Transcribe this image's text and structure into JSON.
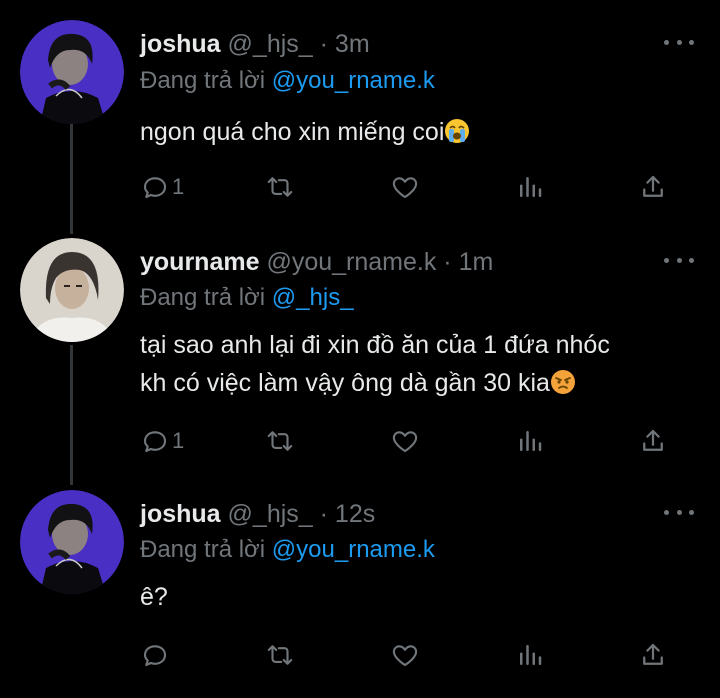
{
  "colors": {
    "background": "#000000",
    "text": "#e7e9ea",
    "muted": "#71767b",
    "accent": "#1d9bf0",
    "thread_line": "#333639"
  },
  "tweets": [
    {
      "name": "joshua",
      "handle": "@_hjs_",
      "separator": "·",
      "time": "3m",
      "replying_prefix": "Đang trả lời",
      "replying_to": "@you_rname.k",
      "text": "ngon quá cho xin miếng coi",
      "emoji": "loudly-crying-face",
      "reply_count": "1",
      "avatar": "joshua-avatar"
    },
    {
      "name": "yourname",
      "handle": "@you_rname.k",
      "separator": "·",
      "time": "1m",
      "replying_prefix": "Đang trả lời",
      "replying_to": "@_hjs_",
      "text_line1": "tại sao anh lại đi xin đồ ăn của 1 đứa nhóc",
      "text_line2": "kh có việc làm vậy ông dà gần 30 kia",
      "emoji": "angry-face",
      "reply_count": "1",
      "avatar": "yourname-avatar"
    },
    {
      "name": "joshua",
      "handle": "@_hjs_",
      "separator": "·",
      "time": "12s",
      "replying_prefix": "Đang trả lời",
      "replying_to": "@you_rname.k",
      "text": "ê?",
      "reply_count": "",
      "avatar": "joshua-avatar"
    }
  ],
  "icons": [
    "reply-icon",
    "retweet-icon",
    "like-icon",
    "views-icon",
    "share-icon",
    "more-icon"
  ]
}
